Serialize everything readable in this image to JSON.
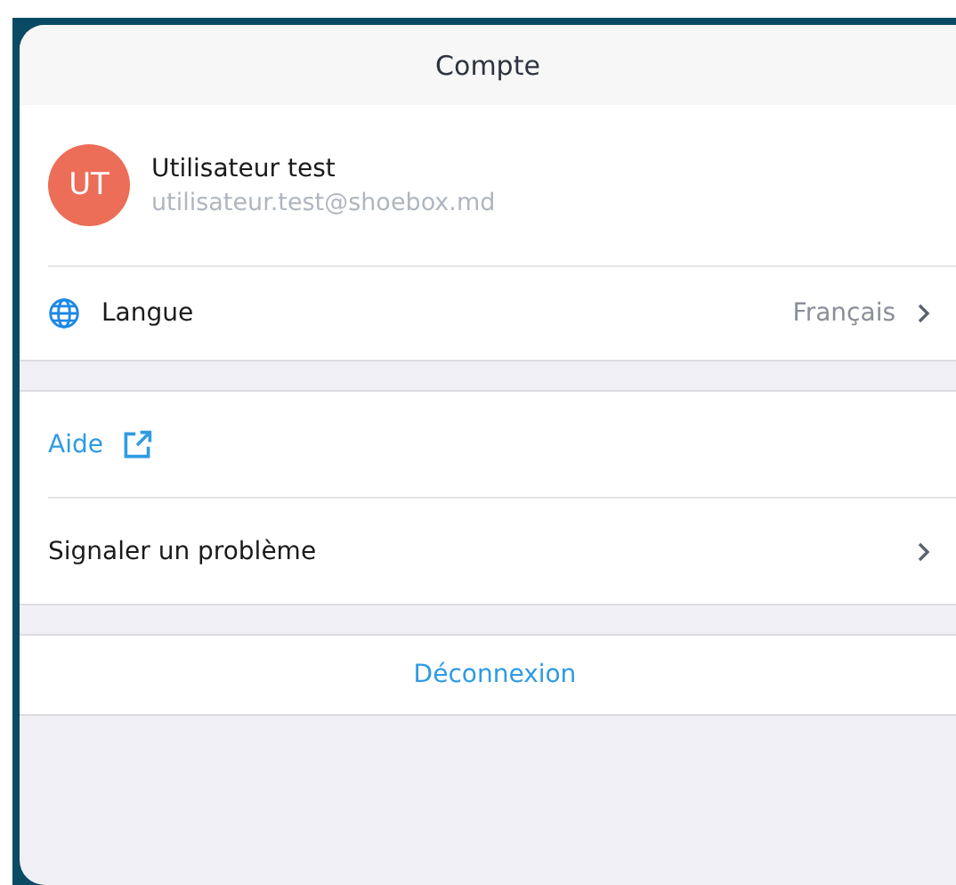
{
  "sheet": {
    "title": "Compte"
  },
  "profile": {
    "initials": "UT",
    "name": "Utilisateur test",
    "email": "utilisateur.test@shoebox.md"
  },
  "groups": [
    {
      "items": [
        {
          "kind": "language",
          "label": "Langue",
          "value": "Français"
        }
      ]
    },
    {
      "items": [
        {
          "kind": "external_link",
          "label": "Aide"
        },
        {
          "kind": "navigate",
          "label": "Signaler un problème"
        }
      ]
    },
    {
      "items": [
        {
          "kind": "action",
          "label": "Déconnexion"
        }
      ]
    }
  ]
}
